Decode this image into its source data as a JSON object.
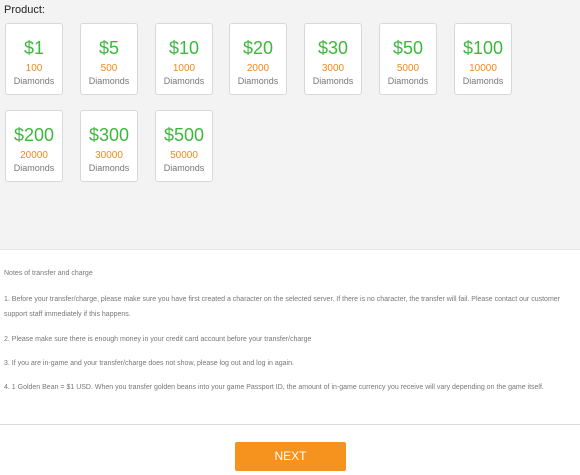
{
  "product": {
    "label": "Product:",
    "items": [
      {
        "price": "$1",
        "amount": "100",
        "unit": "Diamonds"
      },
      {
        "price": "$5",
        "amount": "500",
        "unit": "Diamonds"
      },
      {
        "price": "$10",
        "amount": "1000",
        "unit": "Diamonds"
      },
      {
        "price": "$20",
        "amount": "2000",
        "unit": "Diamonds"
      },
      {
        "price": "$30",
        "amount": "3000",
        "unit": "Diamonds"
      },
      {
        "price": "$50",
        "amount": "5000",
        "unit": "Diamonds"
      },
      {
        "price": "$100",
        "amount": "10000",
        "unit": "Diamonds"
      },
      {
        "price": "$200",
        "amount": "20000",
        "unit": "Diamonds"
      },
      {
        "price": "$300",
        "amount": "30000",
        "unit": "Diamonds"
      },
      {
        "price": "$500",
        "amount": "50000",
        "unit": "Diamonds"
      }
    ]
  },
  "notes": {
    "title": "Notes of transfer and charge",
    "items": [
      "1. Before your transfer/charge, please make sure you have first created a character on the selected server. If there is no character, the transfer will fail. Please contact our customer support staff immediately if this happens.",
      "2. Please make sure there is enough money in your credit card account before your transfer/charge",
      "3. If you are in-game and your transfer/charge does not show, please log out and log in again.",
      "4. 1 Golden Bean = $1 USD. When you transfer golden beans into your game Passport ID, the amount of in-game currency you receive will vary depending on the game itself."
    ]
  },
  "actions": {
    "next_label": "NEXT"
  },
  "colors": {
    "price": "#3db83d",
    "amount": "#f08a1c",
    "button": "#f6921e",
    "section_bg": "#f3f3f3"
  }
}
